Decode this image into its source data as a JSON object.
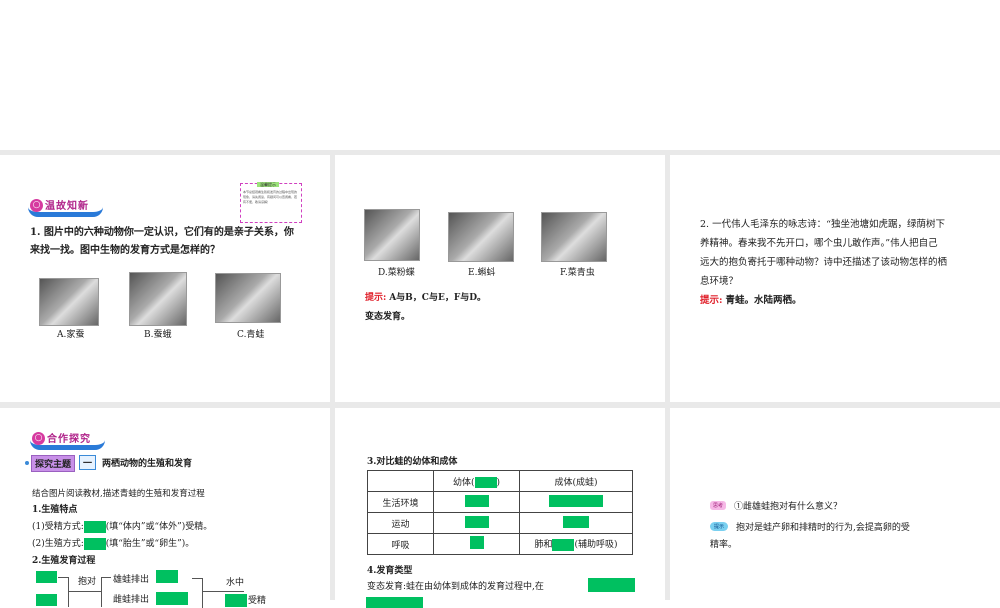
{
  "slides": [
    {
      "banner": "温故知新",
      "note_title": "温馨提示",
      "note_text": "本节总结观看生殖和发育的过程中出现的现象，请先阅读，有疑问可以查阅看，若有不便，敬请谅解！",
      "question": [
        "1. 图片中的六种动物你一定认识，它们有的是亲子关系，你",
        "来找一找。图中生物的发育方式是怎样的？"
      ],
      "captions": [
        "A.家蚕",
        "B.蚕蛾",
        "C.青蛙"
      ]
    },
    {
      "captions": [
        "D.菜粉蝶",
        "E.蝌蚪",
        "F.菜青虫"
      ],
      "hint_label": "提示:",
      "hint": "A与B，C与E，F与D。",
      "hint2": "变态发育。"
    },
    {
      "lines": [
        "2. 一代伟人毛泽东的咏志诗：“独坐池塘如虎踞，绿荫树下",
        "养精神。春来我不先开口，哪个虫儿敢作声。”伟人把自己",
        "远大的抱负寄托于哪种动物？诗中还描述了该动物怎样的栖",
        "息环境？"
      ],
      "hint_label": "提示:",
      "hint": "青蛙。水陆两栖。"
    },
    {
      "banner": "合作探究",
      "topic_label": "探究主题",
      "topic_num": "一",
      "topic_title": "两栖动物的生殖和发育",
      "intro": "结合图片阅读教材,描述青蛙的生殖和发育过程",
      "s1": "1.生殖特点",
      "s1a_pre": "(1)受精方式:",
      "s1a_post": "(填“体内”或“体外”)受精。",
      "s1b_pre": "(2)生殖方式:",
      "s1b_post": "(填“胎生”或“卵生”)。",
      "s2": "2.生殖发育过程",
      "flow": {
        "pair": "抱对",
        "male": "雄蛙排出",
        "female": "雌蛙排出",
        "water": "水中",
        "fert": "受精"
      }
    },
    {
      "s3": "3.对比蛙的幼体和成体",
      "table": {
        "h1_pre": "幼体(",
        "h1_post": ")",
        "h2": "成体(成蛙)",
        "rows": [
          "生活环境",
          "运动",
          "呼吸"
        ],
        "breath_pre": "肺和",
        "breath_post": "(辅助呼吸)"
      },
      "s4": "4.发育类型",
      "s4_text": "变态发育:蛙在由幼体到成体的发育过程中,在"
    },
    {
      "think_badge": "思考",
      "think": "①雌雄蛙抱对有什么意义？",
      "hint_badge": "提示",
      "hint": [
        "抱对是蛙产卵和排精时的行为,会提高卵的受",
        "精率。"
      ]
    }
  ],
  "colors": {
    "blank": "#00c060",
    "hint": "#e0202a",
    "banner": "#2a7ad8"
  }
}
